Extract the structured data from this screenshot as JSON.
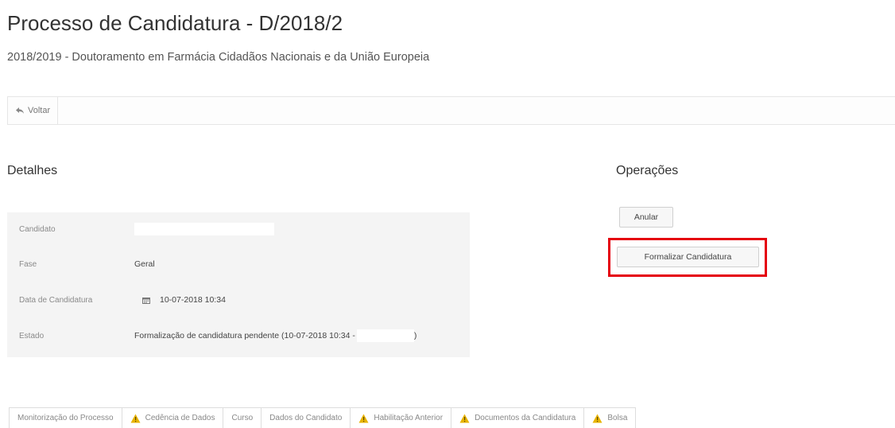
{
  "header": {
    "title": "Processo de Candidatura - D/2018/2",
    "subtitle": "2018/2019 - Doutoramento em Farmácia Cidadãos Nacionais e da União Europeia"
  },
  "toolbar": {
    "back_label": "Voltar",
    "back_icon": "reply-arrow-icon"
  },
  "details": {
    "title": "Detalhes",
    "rows": [
      {
        "label": "Candidato",
        "value": ""
      },
      {
        "label": "Fase",
        "value": "Geral"
      },
      {
        "label": "Data de Candidatura",
        "value": "10-07-2018 10:34",
        "icon": "calendar-icon"
      },
      {
        "label": "Estado",
        "value": "Formalização de candidatura pendente (10-07-2018 10:34 -",
        "value_suffix": ")"
      }
    ]
  },
  "operations": {
    "title": "Operações",
    "annul_label": "Anular",
    "formalize_label": "Formalizar Candidatura",
    "highlight_color": "#e5000e"
  },
  "tabs": [
    {
      "label": "Monitorização do Processo",
      "warning": false
    },
    {
      "label": "Cedência de Dados",
      "warning": true
    },
    {
      "label": "Curso",
      "warning": false
    },
    {
      "label": "Dados do Candidato",
      "warning": false
    },
    {
      "label": "Habilitação Anterior",
      "warning": true
    },
    {
      "label": "Documentos da Candidatura",
      "warning": true
    },
    {
      "label": "Bolsa",
      "warning": true
    }
  ],
  "colors": {
    "warning": "#e8b400"
  }
}
